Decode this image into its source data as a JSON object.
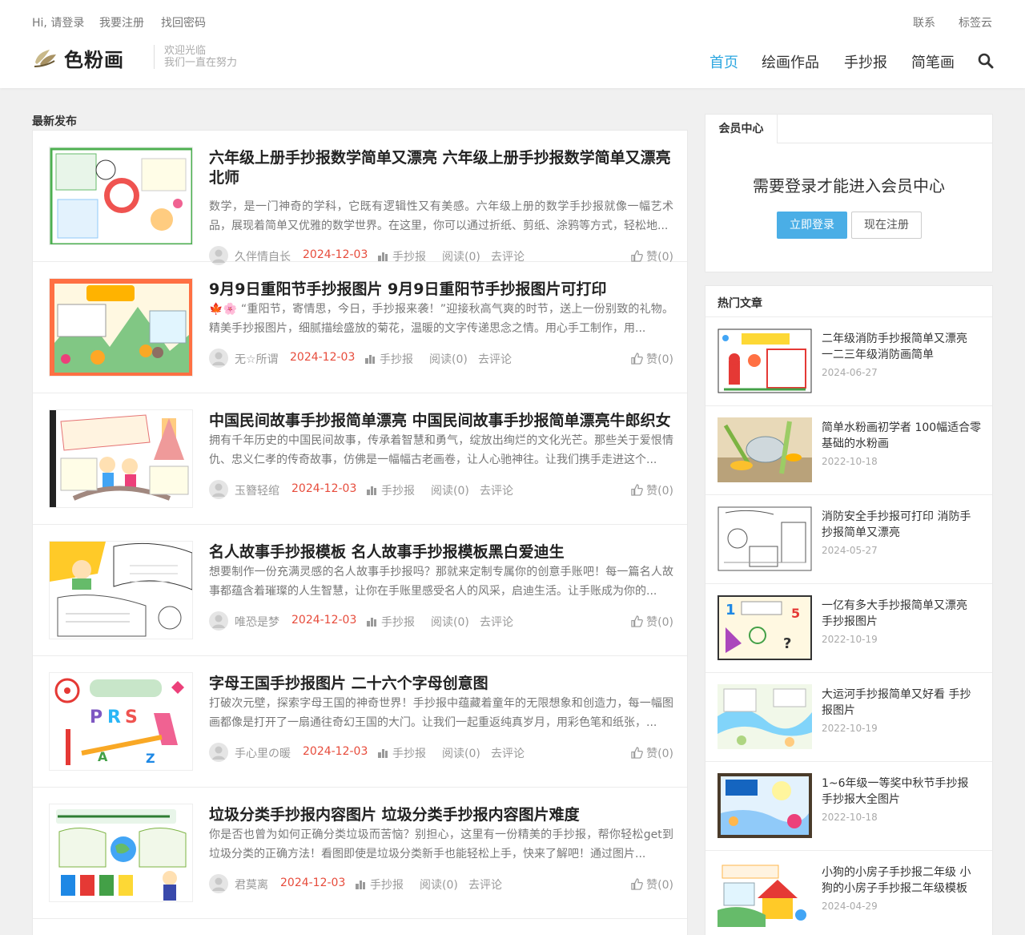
{
  "topbar": {
    "greeting": "Hi, 请登录",
    "register": "我要注册",
    "recover": "找回密码",
    "contact": "联系",
    "tagcloud": "标签云"
  },
  "brand": {
    "name": "色粉画",
    "slogan_line1": "欢迎光临",
    "slogan_line2": "我们一直在努力"
  },
  "nav": {
    "items": [
      "首页",
      "绘画作品",
      "手抄报",
      "简笔画"
    ],
    "active_color": "#2ea7e0"
  },
  "section_title": "最新发布",
  "posts": [
    {
      "title": "六年级上册手抄报数学简单又漂亮 六年级上册手抄报数学简单又漂亮北师",
      "excerpt": "数学，是一门神奇的学科，它既有逻辑性又有美感。六年级上册的数学手抄报就像一幅艺术品，展现着简单又优雅的数学世界。在这里，你可以通过折纸、剪纸、涂鸦等方式，轻松地...",
      "author": "久伴情自长",
      "date": "2024-12-03",
      "category": "手抄报",
      "views": "阅读(0)",
      "comments": "去评论",
      "likes": "赞(0)"
    },
    {
      "title": "9月9日重阳节手抄报图片 9月9日重阳节手抄报图片可打印",
      "excerpt": "🍁🌸 “重阳节，寄情思，今日，手抄报来袭！”迎接秋高气爽的时节，送上一份别致的礼物。精美手抄报图片，细腻描绘盛放的菊花，温暖的文字传递思念之情。用心手工制作，用...",
      "author": "无☆所谓",
      "date": "2024-12-03",
      "category": "手抄报",
      "views": "阅读(0)",
      "comments": "去评论",
      "likes": "赞(0)"
    },
    {
      "title": "中国民间故事手抄报简单漂亮 中国民间故事手抄报简单漂亮牛郎织女",
      "excerpt": "拥有千年历史的中国民间故事，传承着智慧和勇气，绽放出绚烂的文化光芒。那些关于爱恨情仇、忠义仁孝的传奇故事，仿佛是一幅幅古老画卷，让人心驰神往。让我们携手走进这个...",
      "author": "玉簪轻绾",
      "date": "2024-12-03",
      "category": "手抄报",
      "views": "阅读(0)",
      "comments": "去评论",
      "likes": "赞(0)"
    },
    {
      "title": "名人故事手抄报模板 名人故事手抄报模板黑白爱迪生",
      "excerpt": "想要制作一份充满灵感的名人故事手抄报吗？那就来定制专属你的创意手账吧！每一篇名人故事都蕴含着璀璨的人生智慧，让你在手账里感受名人的风采，启迪生活。让手账成为你的...",
      "author": "唯恐是梦",
      "date": "2024-12-03",
      "category": "手抄报",
      "views": "阅读(0)",
      "comments": "去评论",
      "likes": "赞(0)"
    },
    {
      "title": "字母王国手抄报图片 二十六个字母创意图",
      "excerpt": "打破次元壁，探索字母王国的神奇世界！手抄报中蕴藏着童年的无限想象和创造力，每一幅图画都像是打开了一扇通往奇幻王国的大门。让我们一起重返纯真岁月，用彩色笔和纸张，...",
      "author": "手心里の暖",
      "date": "2024-12-03",
      "category": "手抄报",
      "views": "阅读(0)",
      "comments": "去评论",
      "likes": "赞(0)"
    },
    {
      "title": "垃圾分类手抄报内容图片 垃圾分类手抄报内容图片难度",
      "excerpt": "你是否也曾为如何正确分类垃圾而苦恼？别担心，这里有一份精美的手抄报，帮你轻松get到垃圾分类的正确方法！看图即使是垃圾分类新手也能轻松上手，快来了解吧！通过图片...",
      "author": "君莫离",
      "date": "2024-12-03",
      "category": "手抄报",
      "views": "阅读(0)",
      "comments": "去评论",
      "likes": "赞(0)"
    }
  ],
  "member": {
    "tab": "会员中心",
    "message": "需要登录才能进入会员中心",
    "login": "立即登录",
    "register": "现在注册"
  },
  "hot": {
    "title": "热门文章",
    "items": [
      {
        "title": "二年级消防手抄报简单又漂亮 一二三年级消防画简单",
        "date": "2024-06-27"
      },
      {
        "title": "简单水粉画初学者 100幅适合零基础的水粉画",
        "date": "2022-10-18"
      },
      {
        "title": "消防安全手抄报可打印 消防手抄报简单又漂亮",
        "date": "2024-05-27"
      },
      {
        "title": "一亿有多大手抄报简单又漂亮 手抄报图片",
        "date": "2022-10-19"
      },
      {
        "title": "大运河手抄报简单又好看 手抄报图片",
        "date": "2022-10-19"
      },
      {
        "title": "1~6年级一等奖中秋节手抄报 手抄报大全图片",
        "date": "2022-10-18"
      },
      {
        "title": "小狗的小房子手抄报二年级 小狗的小房子手抄报二年级模板",
        "date": "2024-04-29"
      }
    ]
  },
  "colors": {
    "accent": "#2ea7e0",
    "date_red": "#e74c3c",
    "login_button": "#4aaee6"
  }
}
